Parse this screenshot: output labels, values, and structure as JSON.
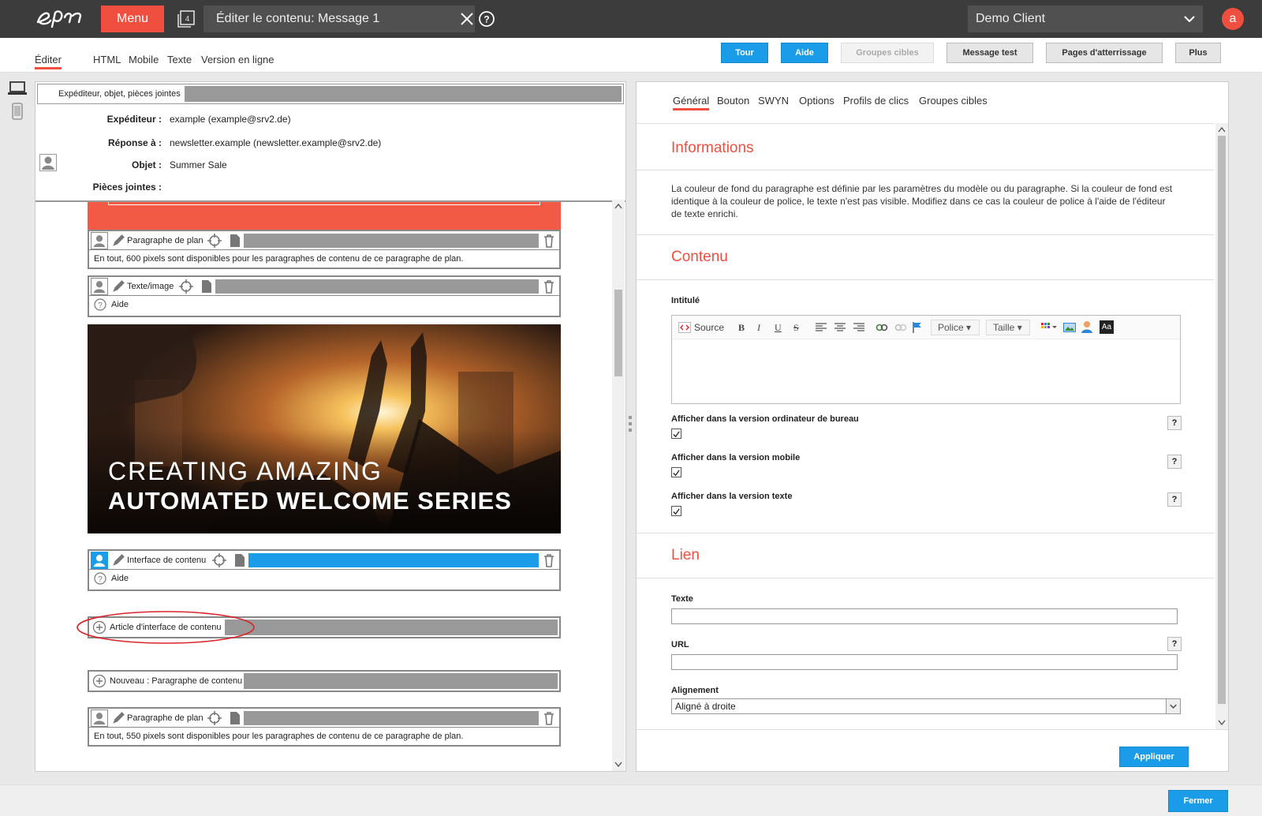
{
  "topbar": {
    "menu_label": "Menu",
    "tabs_count": "4",
    "document_title": "Éditer le contenu: Message 1",
    "client_name": "Demo Client",
    "avatar_letter": "a"
  },
  "subtabs": [
    "Éditer",
    "HTML",
    "Mobile",
    "Texte",
    "Version en ligne"
  ],
  "actions": {
    "tour": "Tour",
    "aide": "Aide",
    "groupes": "Groupes cibles",
    "message_test": "Message test",
    "pages": "Pages d'atterrissage",
    "plus": "Plus"
  },
  "envelope": {
    "bar_label": "Expéditeur, objet, pièces jointes",
    "rows": [
      {
        "key": "Expéditeur :",
        "value": "example (example@srv2.de)"
      },
      {
        "key": "Réponse à :",
        "value": "newsletter.example (newsletter.example@srv2.de)"
      },
      {
        "key": "Objet :",
        "value": "Summer Sale"
      },
      {
        "key": "Pièces jointes :",
        "value": ""
      }
    ]
  },
  "canvas": {
    "para1_label": "Paragraphe de plan",
    "para1_body": "En tout, 600 pixels sont disponibles pour les paragraphes de contenu de ce paragraphe de plan.",
    "para2_label": "Texte/image",
    "para2_help": "Aide",
    "hero_line1": "CREATING AMAZING",
    "hero_line2": "AUTOMATED WELCOME SERIES",
    "para3_label": "Interface de contenu",
    "para3_help": "Aide",
    "add_article": "Article d'interface de contenu",
    "add_new": "Nouveau : Paragraphe de contenu",
    "para4_label": "Paragraphe de plan",
    "para4_body": "En tout, 550 pixels sont disponibles pour les paragraphes de contenu de ce paragraphe de plan."
  },
  "right": {
    "tabs": [
      "Général",
      "Bouton",
      "SWYN",
      "Options",
      "Profils de clics",
      "Groupes cibles"
    ],
    "info_title": "Informations",
    "info_text": "La couleur de fond du paragraphe est définie par les paramètres du modèle ou du paragraphe. Si la couleur de fond est identique à la couleur de police, le texte n'est pas visible. Modifiez dans ce cas la couleur de police à l'aide de l'éditeur de texte enrichi.",
    "content_title": "Contenu",
    "intitule_label": "Intitulé",
    "toolbar": {
      "source": "Source",
      "police": "Police",
      "taille": "Taille",
      "aa": "Aa"
    },
    "chk_desktop": "Afficher dans la version ordinateur de bureau",
    "chk_mobile": "Afficher dans la version mobile",
    "chk_text": "Afficher dans la version texte",
    "lien_title": "Lien",
    "texte_label": "Texte",
    "url_label": "URL",
    "align_label": "Alignement",
    "align_value": "Aligné à droite",
    "apply": "Appliquer",
    "help_mark": "?"
  },
  "footer": {
    "close": "Fermer"
  },
  "colors": {
    "accent": "#f04e3e",
    "primary": "#1b9ce9",
    "topbar": "#3c3c3c"
  }
}
